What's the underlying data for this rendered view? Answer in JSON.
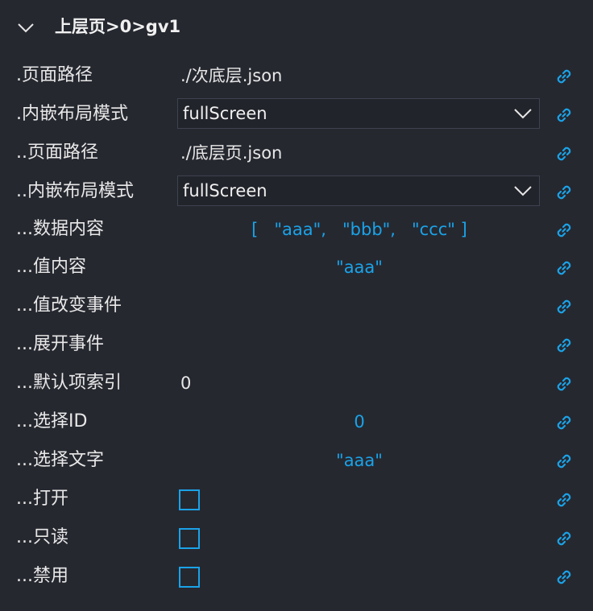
{
  "header": {
    "title": "上层页>0>gv1"
  },
  "rows": [
    {
      "label": ".页面路径",
      "value": "./次底层.json"
    },
    {
      "label": ".内嵌布局模式",
      "select_value": "fullScreen"
    },
    {
      "label": "..页面路径",
      "value": "./底层页.json"
    },
    {
      "label": "..内嵌布局模式",
      "select_value": "fullScreen"
    },
    {
      "label": "...数据内容",
      "value": "[   \"aaa\",   \"bbb\",   \"ccc\" ]"
    },
    {
      "label": "...值内容",
      "value": "\"aaa\""
    },
    {
      "label": "...值改变事件"
    },
    {
      "label": "...展开事件"
    },
    {
      "label": "...默认项索引",
      "value": "0"
    },
    {
      "label": "...选择ID",
      "value": "0"
    },
    {
      "label": "...选择文字",
      "value": "\"aaa\""
    },
    {
      "label": "...打开",
      "checked": false
    },
    {
      "label": "...只读",
      "checked": false
    },
    {
      "label": "...禁用",
      "checked": false
    }
  ],
  "icons": {
    "collapse": "chevron-down-icon",
    "link": "link-icon",
    "dropdown": "chevron-down-icon"
  },
  "colors": {
    "background": "#262830",
    "accent": "#1aa3e8",
    "text": "#e8e8e8",
    "border": "#3e4350"
  }
}
